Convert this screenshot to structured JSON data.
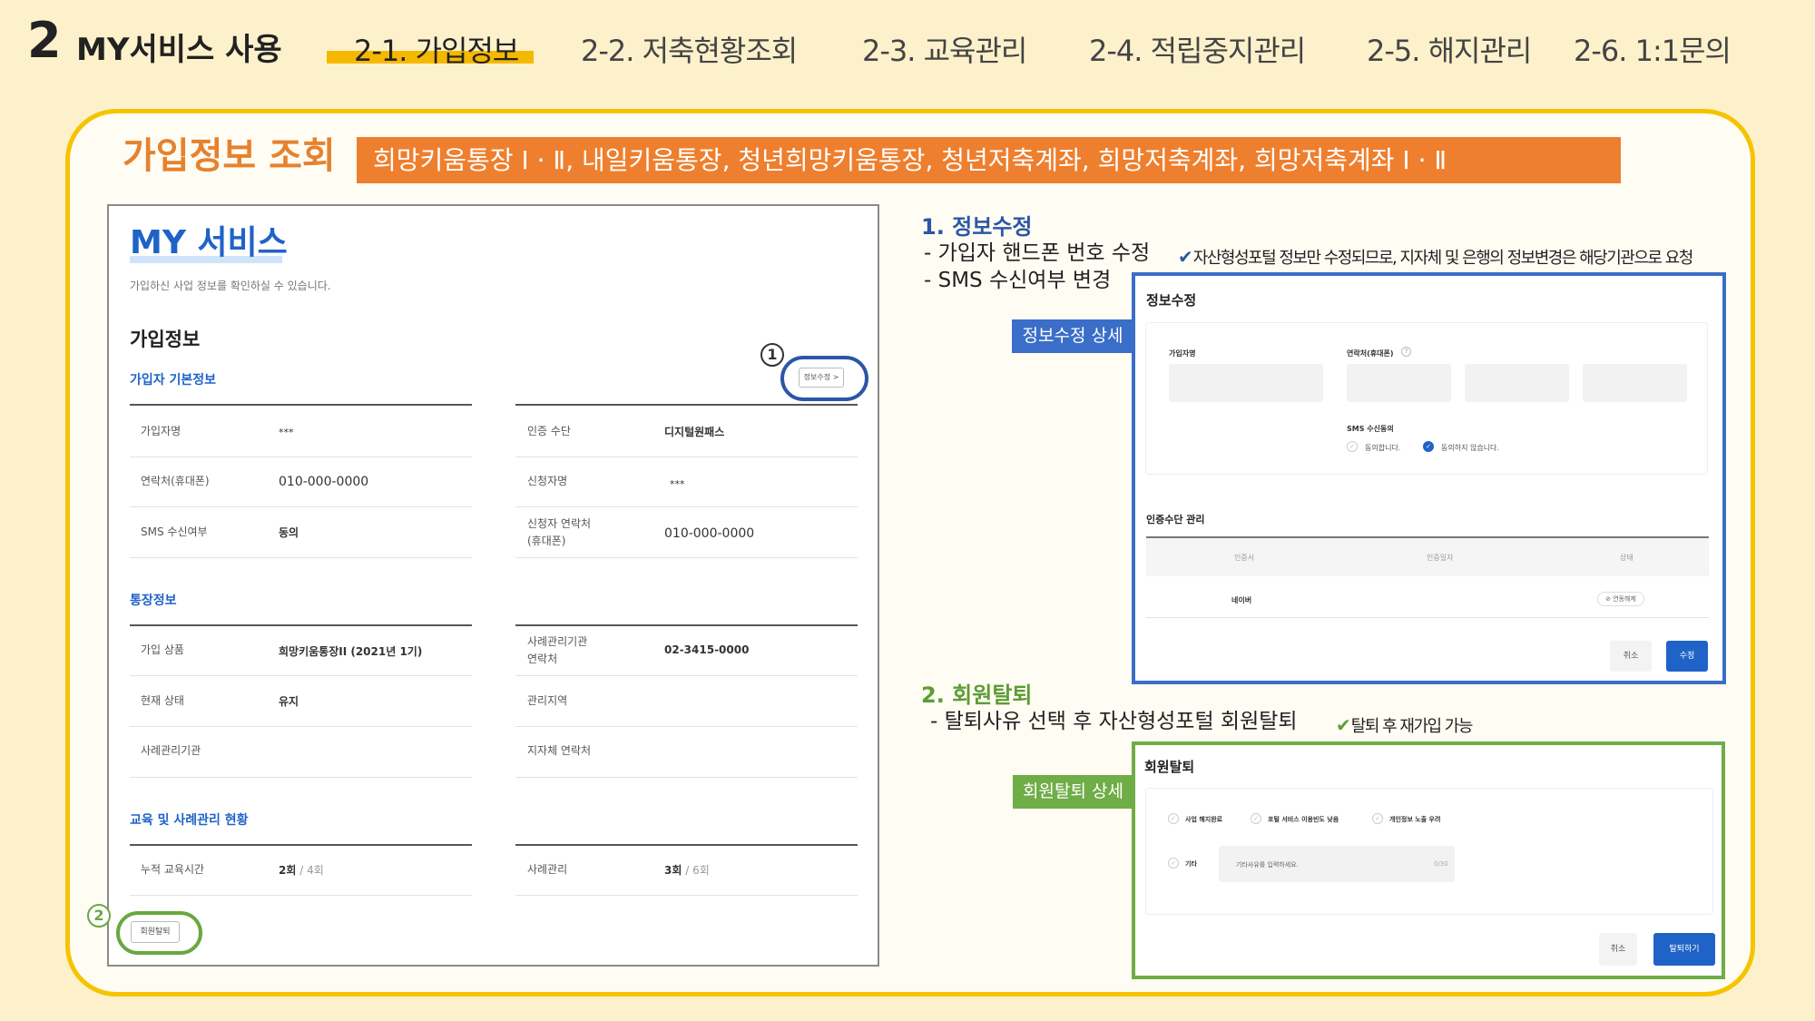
{
  "header": {
    "section_number": "2",
    "section_title": "MY서비스 사용",
    "nav": [
      {
        "label": "2-1. 가입정보"
      },
      {
        "label": "2-2. 저축현황조회"
      },
      {
        "label": "2-3. 교육관리"
      },
      {
        "label": "2-4. 적립중지관리"
      },
      {
        "label": "2-5. 해지관리"
      },
      {
        "label": "2-6. 1:1문의"
      }
    ],
    "active_nav": "2-1. 가입정보"
  },
  "main": {
    "title": "가입정보 조회",
    "banner": "희망키움통장 Ⅰ · Ⅱ, 내일키움통장, 청년희망키움통장, 청년저축계좌, 희망저축계좌, 희망저축계좌 Ⅰ · Ⅱ"
  },
  "screen": {
    "title": "MY 서비스",
    "description": "가입하신 사업 정보를 확인하실 수 있습니다.",
    "heading": "가입정보",
    "edit_button": "정보수정 >",
    "leave_button": "회원탈퇴",
    "marker_1": "1",
    "marker_2": "2",
    "basic": {
      "title": "가입자 기본정보",
      "left_rows": [
        {
          "label": "가입자명",
          "value": "***"
        },
        {
          "label": "연락처(휴대폰)",
          "value": "010-000-0000"
        },
        {
          "label": "SMS 수신여부",
          "value": "동의"
        }
      ],
      "right_rows": [
        {
          "label": "인증 수단",
          "value": "디지털원패스"
        },
        {
          "label": "신청자명",
          "value": "***"
        },
        {
          "label": "신청자 연락처",
          "label2": "(휴대폰)",
          "value": "010-000-0000"
        }
      ]
    },
    "account": {
      "title": "통장정보",
      "left_rows": [
        {
          "label": "가입 상품",
          "value": "희망키움통장II (2021년 1기)"
        },
        {
          "label": "현재 상태",
          "value": "유지"
        },
        {
          "label": "사례관리기관",
          "value": ""
        }
      ],
      "right_rows": [
        {
          "label": "사례관리기관",
          "label2": "연락처",
          "value": "02-3415-0000"
        },
        {
          "label": "관리지역",
          "value": ""
        },
        {
          "label": "지자체 연락처",
          "value": ""
        }
      ]
    },
    "education": {
      "title": "교육 및 사례관리 현황",
      "left": {
        "label": "누적 교육시간",
        "value": "2회",
        "total": " / 4회"
      },
      "right": {
        "label": "사례관리",
        "value": "3회",
        "total": " / 6회"
      }
    }
  },
  "info_edit": {
    "title": "1. 정보수정",
    "line1": "- 가입자 핸드폰 번호 수정",
    "note": "자산형성포털 정보만 수정되므로, 지자체 및 은행의 정보변경은 해당기관으로 요청",
    "line2": "- SMS 수신여부 변경",
    "tag": "정보수정 상세",
    "panel": {
      "title": "정보수정",
      "name_label": "가입자명",
      "phone_label": "연락처(휴대폰)",
      "sms_label": "SMS 수신동의",
      "sms_agree": "동의합니다.",
      "sms_disagree": "동의하지 않습니다.",
      "auth_title": "인증수단 관리",
      "col1": "인증서",
      "col2": "인증일자",
      "col3": "상태",
      "row_name": "네이버",
      "row_status": "연동해제",
      "cancel": "취소",
      "submit": "수정"
    }
  },
  "withdraw": {
    "title": "2. 회원탈퇴",
    "line1": "- 탈퇴사유 선택 후 자산형성포털 회원탈퇴",
    "note": "탈퇴 후 재가입 가능",
    "tag": "회원탈퇴 상세",
    "panel": {
      "title": "회원탈퇴",
      "reason1": "사업 해지완료",
      "reason2": "포털 서비스 이용빈도 낮음",
      "reason3": "개인정보 노출 우려",
      "reason4": "기타",
      "placeholder": "기타사유를 입력하세요.",
      "counter": "0/30",
      "cancel": "취소",
      "submit": "탈퇴하기"
    }
  },
  "colors": {
    "accent_orange": "#ee7f2e",
    "frame_yellow": "#f5c400",
    "blue": "#3a6ec8",
    "green": "#6fad47"
  }
}
